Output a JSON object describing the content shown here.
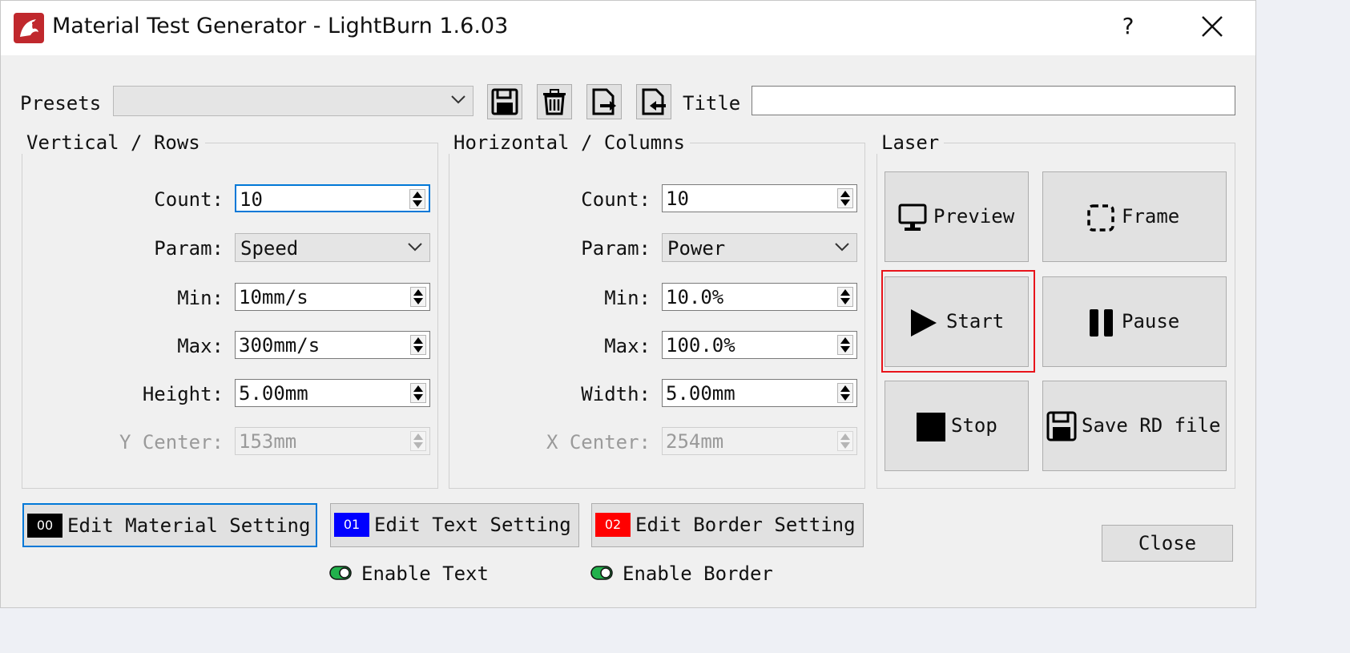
{
  "window": {
    "title": "Material Test Generator - LightBurn 1.6.03",
    "help_label": "?"
  },
  "presets": {
    "label": "Presets",
    "selected": "",
    "title_label": "Title",
    "title_value": ""
  },
  "vertical": {
    "group_title": "Vertical / Rows",
    "count_label": "Count:",
    "count_value": "10",
    "param_label": "Param:",
    "param_value": "Speed",
    "min_label": "Min:",
    "min_value": "10mm/s",
    "max_label": "Max:",
    "max_value": "300mm/s",
    "size_label": "Height:",
    "size_value": "5.00mm",
    "center_label": "Y Center:",
    "center_value": "153mm"
  },
  "horizontal": {
    "group_title": "Horizontal / Columns",
    "count_label": "Count:",
    "count_value": "10",
    "param_label": "Param:",
    "param_value": "Power",
    "min_label": "Min:",
    "min_value": "10.0%",
    "max_label": "Max:",
    "max_value": "100.0%",
    "size_label": "Width:",
    "size_value": "5.00mm",
    "center_label": "X Center:",
    "center_value": "254mm"
  },
  "laser": {
    "group_title": "Laser",
    "preview_label": "Preview",
    "frame_label": "Frame",
    "start_label": "Start",
    "pause_label": "Pause",
    "stop_label": "Stop",
    "save_label": "Save RD file"
  },
  "settings": {
    "material_swatch": "00",
    "material_label": "Edit Material Setting",
    "material_color": "#000000",
    "text_swatch": "01",
    "text_label": "Edit Text Setting",
    "text_color": "#0000ff",
    "border_swatch": "02",
    "border_label": "Edit Border Setting",
    "border_color": "#ff0000",
    "enable_text_label": "Enable Text",
    "enable_text_on": true,
    "enable_border_label": "Enable Border",
    "enable_border_on": true
  },
  "footer": {
    "close_label": "Close"
  },
  "colors": {
    "highlight": "#e8141b",
    "focus": "#0078d7",
    "toggle_on": "#22b14c"
  }
}
